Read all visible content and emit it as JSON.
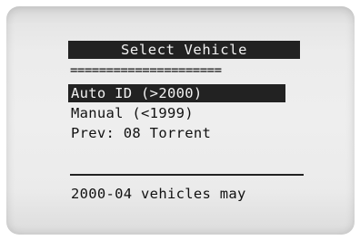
{
  "screen": {
    "title": "Select Vehicle",
    "separator": "=====================",
    "menu": [
      {
        "label": "Auto ID (>2000)",
        "selected": true
      },
      {
        "label": "Manual (<1999)",
        "selected": false
      },
      {
        "label": "Prev: 08 Torrent",
        "selected": false
      }
    ],
    "message": "2000-04 vehicles may"
  },
  "colors": {
    "bezel": "#eeeeee",
    "highlight_bg": "#222222",
    "highlight_fg": "#f2f2f2",
    "text": "#111111"
  }
}
